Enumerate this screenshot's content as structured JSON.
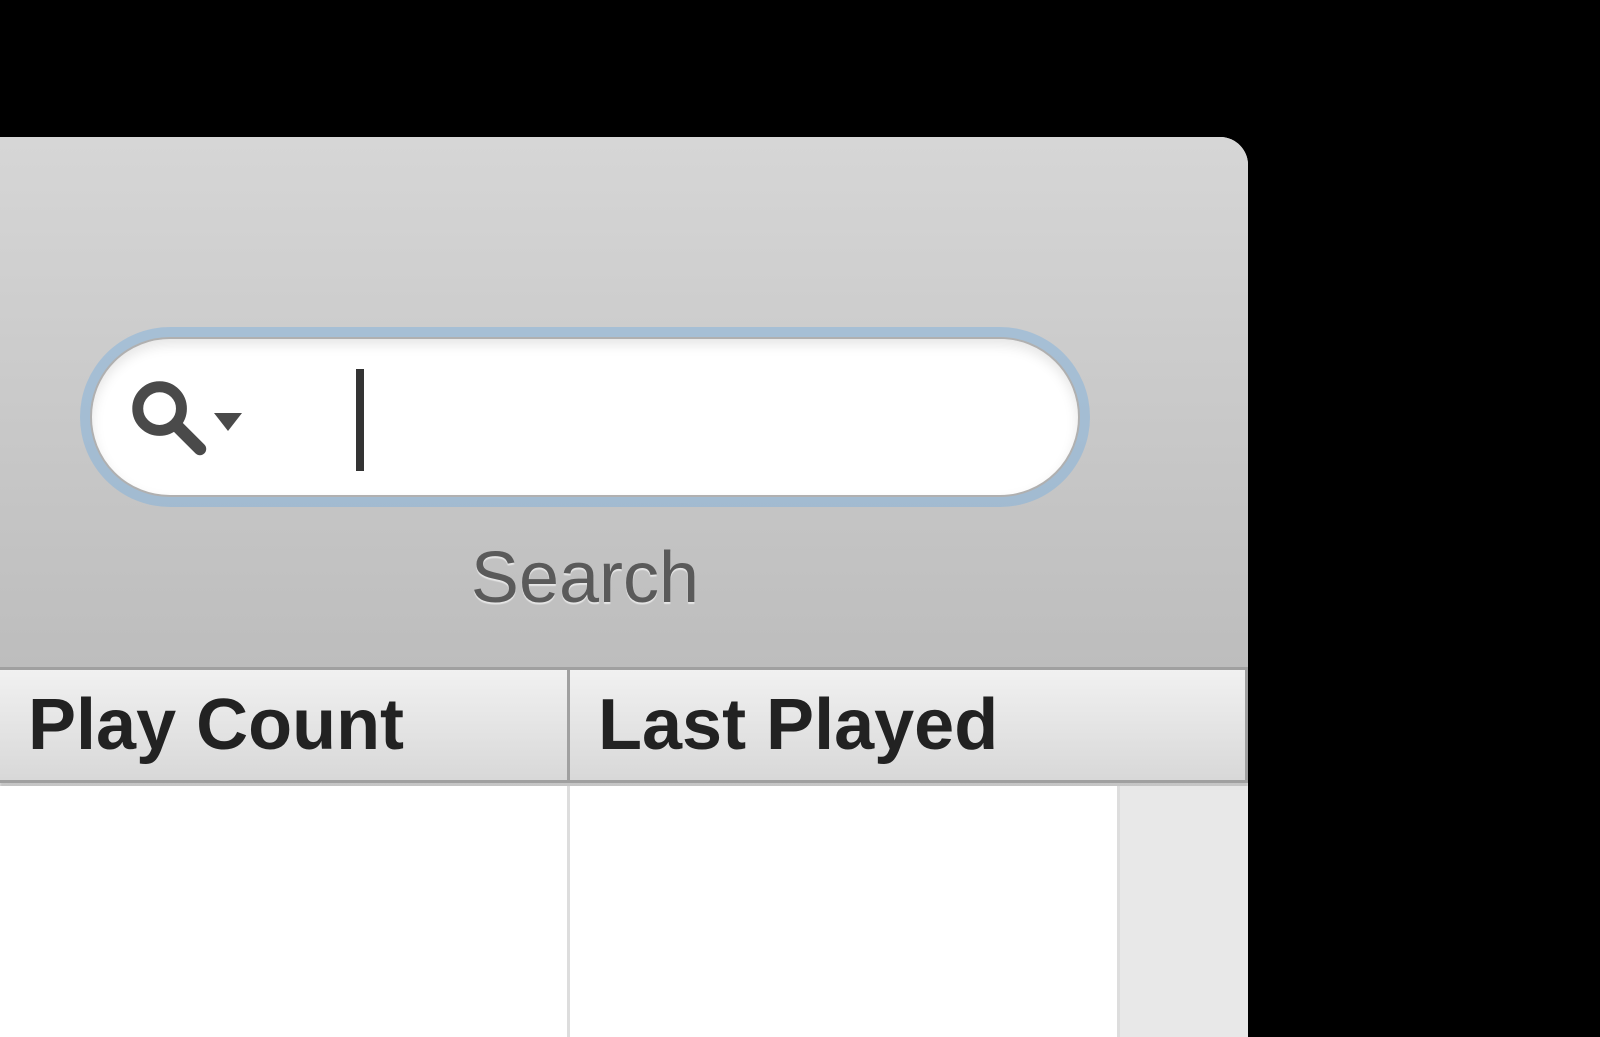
{
  "toolbar": {
    "search": {
      "label": "Search",
      "value": "",
      "placeholder": ""
    }
  },
  "table": {
    "columns": [
      "Play Count",
      "Last Played"
    ]
  }
}
